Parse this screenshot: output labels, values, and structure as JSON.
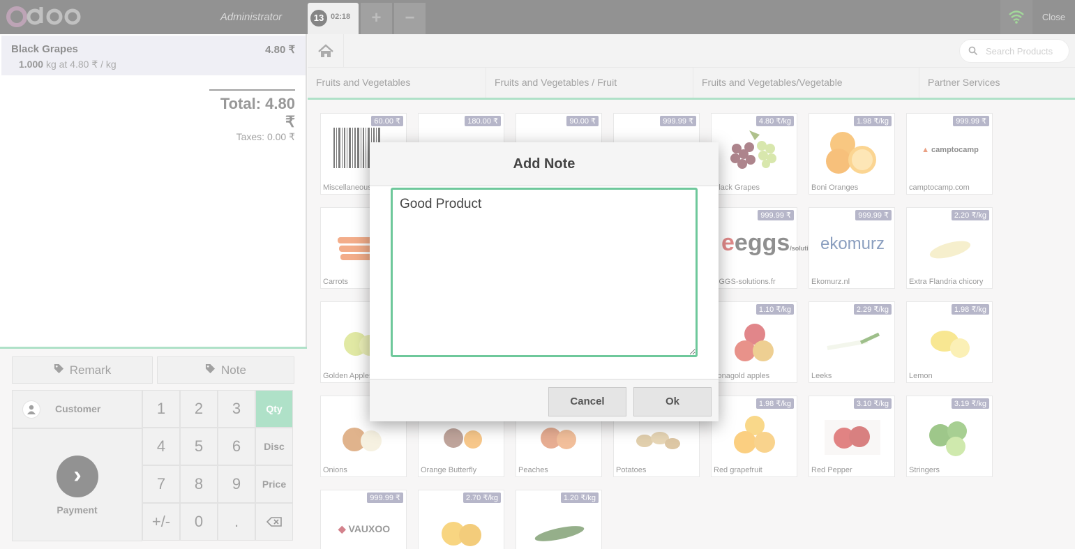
{
  "header": {
    "logo_text": "odoo",
    "user": "Administrator",
    "order_number": "13",
    "order_time": "02:18",
    "add_order": "+",
    "remove_order": "−",
    "close": "Close",
    "wifi_color": "#57b847"
  },
  "order": {
    "line": {
      "name": "Black Grapes",
      "price": "4.80 ₹",
      "qty": "1.000",
      "unit_info": "kg at 4.80 ₹ / kg"
    },
    "total": "Total: 4.80 ₹",
    "taxes": "Taxes: 0.00 ₹"
  },
  "controls": {
    "remark": "Remark",
    "note": "Note",
    "customer": "Customer",
    "payment": "Payment"
  },
  "numpad": {
    "keys": [
      "1",
      "2",
      "3",
      "4",
      "5",
      "6",
      "7",
      "8",
      "9",
      "+/-",
      "0",
      "."
    ],
    "modes": [
      "Qty",
      "Disc",
      "Price"
    ],
    "backspace": "⌫",
    "selected_mode": "Qty"
  },
  "search": {
    "placeholder": "Search Products"
  },
  "categories": [
    "Fruits and Vegetables",
    "Fruits and Vegetables / Fruit",
    "Fruits and Vegetables/Vegetable",
    "Partner Services"
  ],
  "products": [
    {
      "name": "Miscellaneous",
      "price": "60.00 ₹"
    },
    {
      "name": "",
      "price": "180.00 ₹"
    },
    {
      "name": "",
      "price": "90.00 ₹"
    },
    {
      "name": "",
      "price": "999.99 ₹"
    },
    {
      "name": "Black Grapes",
      "price": "4.80 ₹/kg"
    },
    {
      "name": "Boni Oranges",
      "price": "1.98 ₹/kg"
    },
    {
      "name": "camptocamp.com",
      "price": "999.99 ₹"
    },
    {
      "name": "Carrots",
      "price": ""
    },
    {
      "name": "",
      "price": ""
    },
    {
      "name": "",
      "price": ""
    },
    {
      "name": "",
      "price": ""
    },
    {
      "name": "EGGS-solutions.fr",
      "price": "999.99 ₹"
    },
    {
      "name": "Ekomurz.nl",
      "price": "999.99 ₹"
    },
    {
      "name": "Extra Flandria chicory",
      "price": "2.20 ₹/kg"
    },
    {
      "name": "Golden Apples",
      "price": ""
    },
    {
      "name": "",
      "price": ""
    },
    {
      "name": "",
      "price": ""
    },
    {
      "name": "",
      "price": ""
    },
    {
      "name": "Jonagold apples",
      "price": "1.10 ₹/kg"
    },
    {
      "name": "Leeks",
      "price": "2.29 ₹/kg"
    },
    {
      "name": "Lemon",
      "price": "1.98 ₹/kg"
    },
    {
      "name": "Onions",
      "price": ""
    },
    {
      "name": "Orange Butterfly",
      "price": ""
    },
    {
      "name": "Peaches",
      "price": ""
    },
    {
      "name": "Potatoes",
      "price": ""
    },
    {
      "name": "Red grapefruit",
      "price": "1.98 ₹/kg"
    },
    {
      "name": "Red Pepper",
      "price": "3.10 ₹/kg"
    },
    {
      "name": "Stringers",
      "price": "3.19 ₹/kg"
    },
    {
      "name": "",
      "price": "999.99 ₹"
    },
    {
      "name": "",
      "price": "2.70 ₹/kg"
    },
    {
      "name": "",
      "price": "1.20 ₹/kg"
    }
  ],
  "product_logos": {
    "camptocamp": "camptocamp",
    "eggs": "eggs",
    "eggs_sub": "/solutions",
    "ekomurz": "ekomurz",
    "vauxoo": "VAUXOO"
  },
  "modal": {
    "title": "Add Note",
    "note_value": "Good Product",
    "cancel": "Cancel",
    "ok": "Ok"
  },
  "colors": {
    "accent": "#6ec89b",
    "header": "#393939",
    "price_tag": "#7a7a9d"
  }
}
